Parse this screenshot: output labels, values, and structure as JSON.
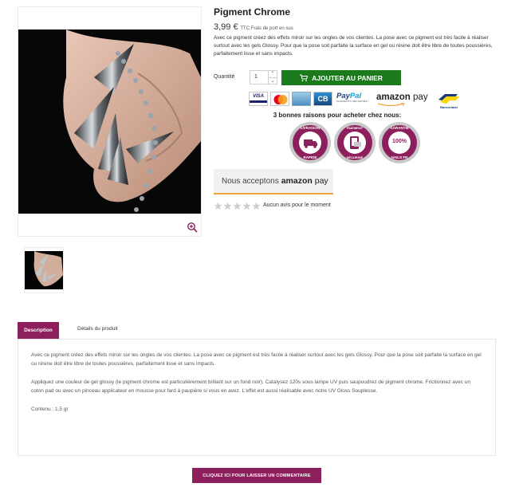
{
  "product": {
    "title": "Pigment Chrome",
    "price": "3,99 €",
    "price_suffix": "TTC Frais de port en sus",
    "short_description": "Avec ce pigment créez des effets miroir sur les ongles de vos clientes. La pose avec ce pigment est très facile à réaliser surtout avec les gels Glossy. Pour que la pose soit parfaite la surface en gel ou résine doit être libre de toutes poussières, parfaitement lisse et sans impacts."
  },
  "purchase": {
    "quantity_label": "Quantité",
    "quantity_value": "1",
    "increment": "⌃",
    "decrement": "⌄",
    "add_to_cart": "AJOUTER AU PANIER"
  },
  "payments": {
    "visa": "VISA",
    "cb": "CB",
    "paypal_pay": "Pay",
    "paypal_pal": "Pal",
    "paypal_sub": "PAIEMENTS SÉCURISÉS",
    "amazon": "amazon",
    "amazon_pay": "pay",
    "bancontact": "Bancontact"
  },
  "reasons": {
    "title": "3 bonnes raisons pour acheter chez nous:",
    "badges": [
      {
        "top": "LIVRAISON",
        "bottom": "RAPIDE"
      },
      {
        "top": "PAIEMENT",
        "bottom": "SÉCURISÉ"
      },
      {
        "top": "GARANTIE",
        "middle": "100%",
        "bottom": "NAILS FR"
      }
    ]
  },
  "amazon_banner": {
    "prefix": "Nous acceptons",
    "brand": "amazon",
    "brand_pay": "pay"
  },
  "reviews": {
    "rating": 0,
    "max": 5,
    "text": "Aucun avis pour le moment"
  },
  "tabs": {
    "description": "Description",
    "details": "Détails du produit"
  },
  "description": {
    "paragraphs": [
      "Avec ce pigment créez des effets miroir sur les ongles de vos clientes. La pose avec ce pigment est très facile à réaliser surtout avec les gels Glossy. Pour que la pose soit parfaite la surface en gel ou résine doit être libre de toutes poussières, parfaitement lisse et sans impacts.",
      "Appliquez une couleur de gel glossy (le pigment chrome est particulièrement brillant sur un fond noir). Catalysez 120s sous lampe UV puis saupoudrez de pigment chrome. Frictionnez avec un coton pad ou avec un pinceau applicateur en mousse pour fard à paupière si vous en avez. L'effet est aussi réalisable avec notre UV Gloss Souplesse.",
      "Contenu : 1,5 gr"
    ]
  },
  "comment_button": "CLIQUEZ ICI POUR LAISSER UN COMMENTAIRE",
  "colors": {
    "brand": "#8d1f5c",
    "cart_green": "#1b7a1b",
    "amazon_orange": "#f0a53c"
  },
  "icons": {
    "zoom": "zoom-in-icon",
    "cart": "cart-icon",
    "star": "star-icon"
  }
}
